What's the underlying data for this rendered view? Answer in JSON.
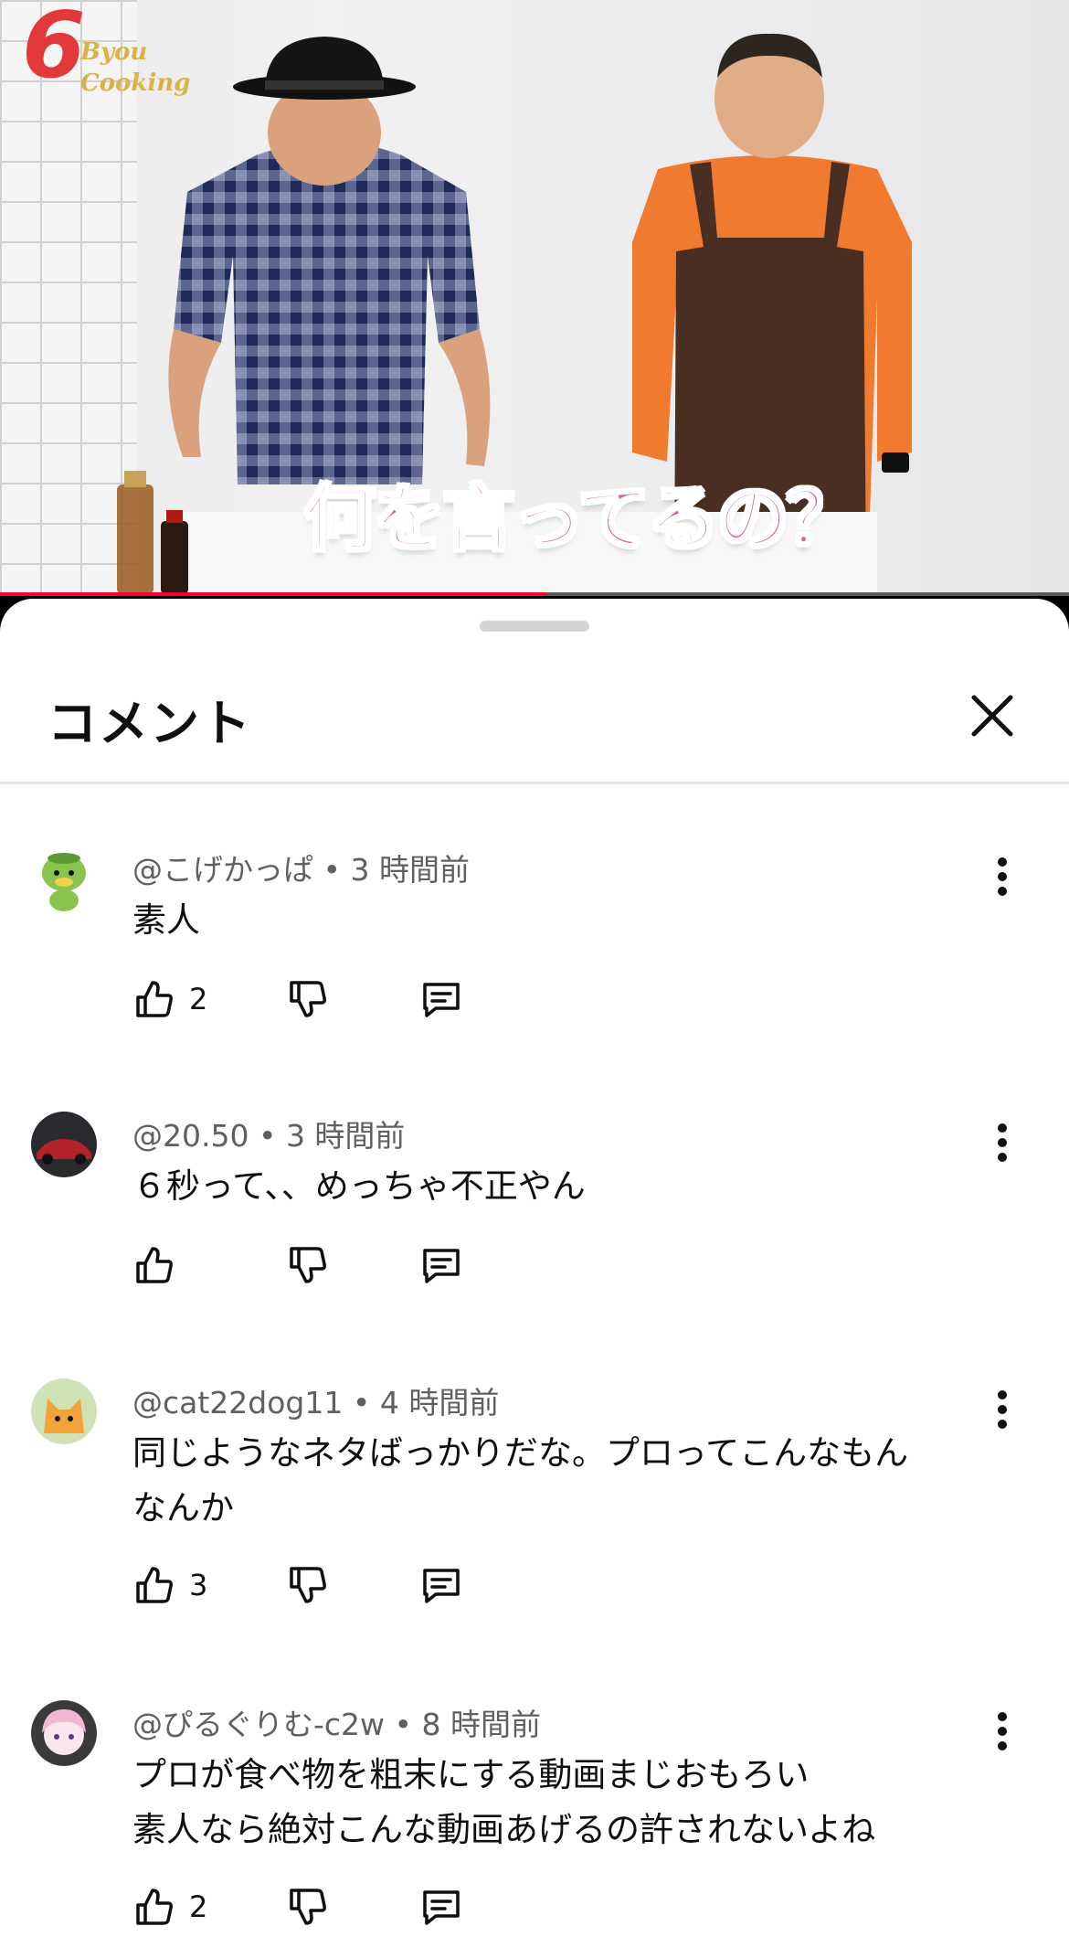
{
  "video": {
    "logo_digit": "6",
    "logo_line1": "Byou",
    "logo_line2": "Cooking",
    "caption": "何を言ってるの？",
    "progress": 0.51
  },
  "comments_panel": {
    "title": "コメント",
    "close_icon": "close-icon",
    "comments": [
      {
        "author": "@こげかっぱ",
        "time": "3 時間前",
        "text": "素人",
        "likes": "2",
        "avatar_color": "#7cc04a"
      },
      {
        "author": "@20.50",
        "time": "3 時間前",
        "text": "６秒って、、めっちゃ不正やん",
        "likes": "",
        "avatar_color": "#b3222a"
      },
      {
        "author": "@cat22dog11",
        "time": "4 時間前",
        "text": "同じようなネタばっかりだな。プロってこんなもん\nなんか",
        "likes": "3",
        "avatar_color": "#f2a33a"
      },
      {
        "author": "@ぴるぐりむ-c2w",
        "time": "8 時間前",
        "text": "プロが食べ物を粗末にする動画まじおもろい\n素人なら絶対こんな動画あげるの許されないよね",
        "likes": "2",
        "avatar_color": "#f4b6d2"
      }
    ]
  },
  "colors": {
    "progress": "#ff0033",
    "caption": "#e05aa6",
    "text": "#0f0f0f",
    "meta": "#606060"
  }
}
